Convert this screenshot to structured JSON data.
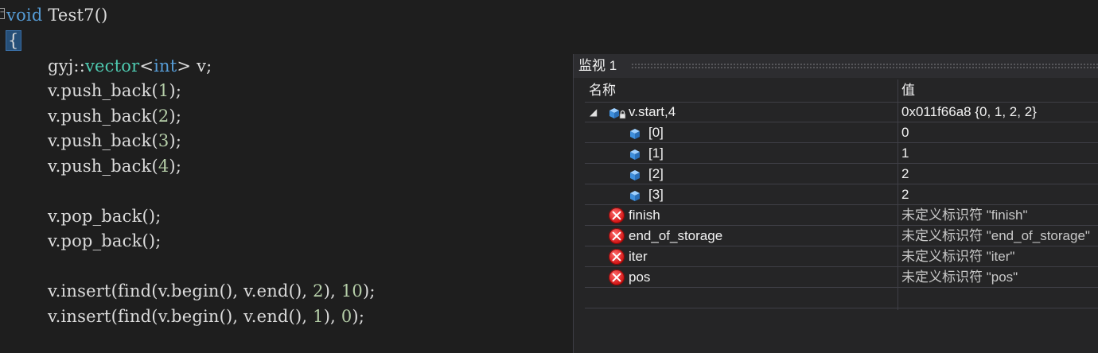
{
  "editor": {
    "lines": [
      {
        "id": "l1",
        "segments": [
          {
            "t": "void",
            "c": "kw"
          },
          {
            "t": " Test7()",
            "c": "plain"
          }
        ]
      },
      {
        "id": "l2",
        "segments": [
          {
            "t": "{",
            "c": "brace-hl"
          }
        ]
      },
      {
        "id": "l3",
        "segments": [
          {
            "t": "gyj::",
            "c": "plain"
          },
          {
            "t": "vector",
            "c": "ty"
          },
          {
            "t": "<",
            "c": "plain"
          },
          {
            "t": "int",
            "c": "kw"
          },
          {
            "t": "> v;",
            "c": "plain"
          }
        ]
      },
      {
        "id": "l4",
        "segments": [
          {
            "t": "v.push_back(",
            "c": "plain"
          },
          {
            "t": "1",
            "c": "num"
          },
          {
            "t": ");",
            "c": "plain"
          }
        ]
      },
      {
        "id": "l5",
        "segments": [
          {
            "t": "v.push_back(",
            "c": "plain"
          },
          {
            "t": "2",
            "c": "num"
          },
          {
            "t": ");",
            "c": "plain"
          }
        ]
      },
      {
        "id": "l6",
        "segments": [
          {
            "t": "v.push_back(",
            "c": "plain"
          },
          {
            "t": "3",
            "c": "num"
          },
          {
            "t": ");",
            "c": "plain"
          }
        ]
      },
      {
        "id": "l7",
        "segments": [
          {
            "t": "v.push_back(",
            "c": "plain"
          },
          {
            "t": "4",
            "c": "num"
          },
          {
            "t": ");",
            "c": "plain"
          }
        ]
      },
      {
        "id": "l8",
        "segments": [
          {
            "t": "v.pop_back();",
            "c": "plain"
          }
        ]
      },
      {
        "id": "l9",
        "segments": [
          {
            "t": "v.pop_back();",
            "c": "plain"
          }
        ]
      },
      {
        "id": "l10",
        "segments": [
          {
            "t": "v.insert(find(v.begin(), v.end(), ",
            "c": "plain"
          },
          {
            "t": "2",
            "c": "num"
          },
          {
            "t": "), ",
            "c": "plain"
          },
          {
            "t": "10",
            "c": "num"
          },
          {
            "t": ");",
            "c": "plain"
          }
        ]
      },
      {
        "id": "l11",
        "segments": [
          {
            "t": "v.insert(find(v.begin(), v.end(), ",
            "c": "plain"
          },
          {
            "t": "1",
            "c": "num"
          },
          {
            "t": "), ",
            "c": "plain"
          },
          {
            "t": "0",
            "c": "num"
          },
          {
            "t": ");",
            "c": "plain"
          }
        ]
      }
    ]
  },
  "watch": {
    "title": "监视 1",
    "col_name": "名称",
    "col_value": "值",
    "rows": [
      {
        "name": "v.start,4",
        "value": "0x011f66a8 {0, 1, 2, 2}",
        "icon": "locked-object-icon",
        "expanded": true,
        "expander": "◢",
        "error": false
      },
      {
        "name": "[0]",
        "value": "0",
        "icon": "field-cube-icon",
        "error": false
      },
      {
        "name": "[1]",
        "value": "1",
        "icon": "field-cube-icon",
        "error": false
      },
      {
        "name": "[2]",
        "value": "2",
        "icon": "field-cube-icon",
        "error": false
      },
      {
        "name": "[3]",
        "value": "2",
        "icon": "field-cube-icon",
        "error": false
      },
      {
        "name": "finish",
        "value": "未定义标识符 \"finish\"",
        "icon": "error-icon",
        "error": true
      },
      {
        "name": "end_of_storage",
        "value": "未定义标识符 \"end_of_storage\"",
        "icon": "error-icon",
        "error": true
      },
      {
        "name": "iter",
        "value": "未定义标识符 \"iter\"",
        "icon": "error-icon",
        "error": true
      },
      {
        "name": "pos",
        "value": "未定义标识符 \"pos\"",
        "icon": "error-icon",
        "error": true
      },
      {
        "name": "",
        "value": "",
        "icon": "",
        "error": false
      }
    ]
  },
  "colors": {
    "keyword": "#569cd6",
    "type": "#4ec9b0",
    "number": "#b5cea8",
    "text": "#dcdcdc",
    "background": "#1e1e1e",
    "panel": "#252526"
  }
}
